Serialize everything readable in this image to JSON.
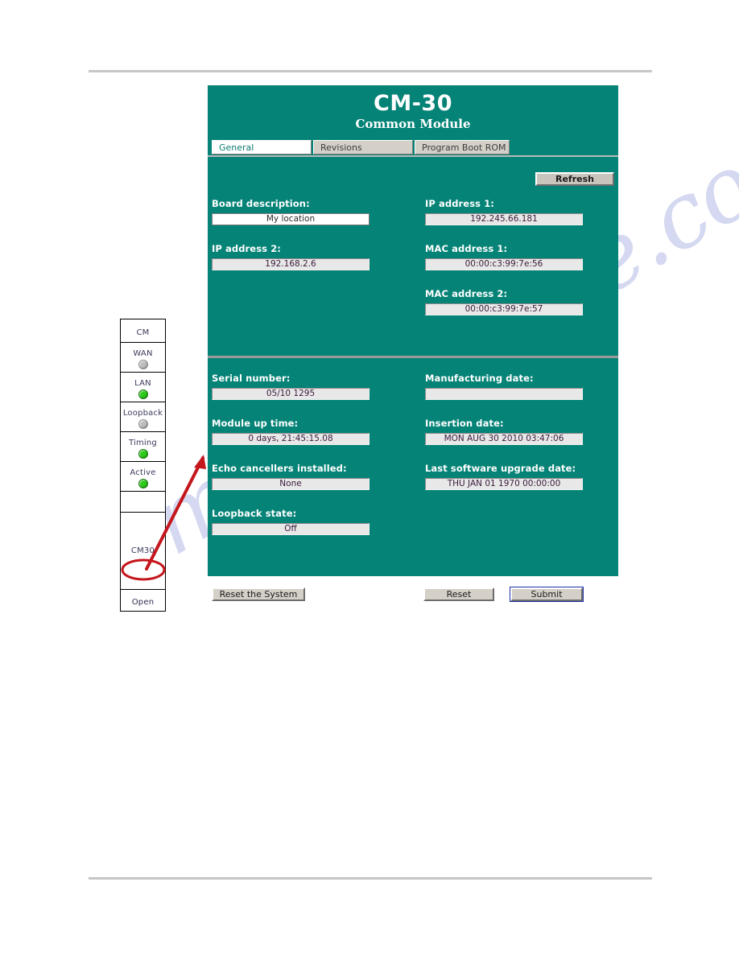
{
  "window": {
    "title": "CM-30",
    "subtitle": "Common Module"
  },
  "watermark": {
    "text": "manualshive.com"
  },
  "tabs": [
    {
      "label": "General",
      "state": "active"
    },
    {
      "label": "Revisions",
      "state": "inactive"
    },
    {
      "label": "Program Boot ROM",
      "state": "inactive"
    }
  ],
  "toolbar": {
    "refresh_label": "Refresh"
  },
  "form": {
    "board_description": {
      "label": "Board description:",
      "value": "My location",
      "editable": true
    },
    "ip_address_1": {
      "label": "IP address 1:",
      "value": "192.245.66.181",
      "editable": false
    },
    "ip_address_2": {
      "label": "IP address 2:",
      "value": "192.168.2.6",
      "editable": false
    },
    "mac_address_1": {
      "label": "MAC address 1:",
      "value": "00:00:c3:99:7e:56",
      "editable": false
    },
    "mac_address_2": {
      "label": "MAC address 2:",
      "value": "00:00:c3:99:7e:57",
      "editable": false
    },
    "serial_number": {
      "label": "Serial number:",
      "value": "05/10 1295",
      "editable": false
    },
    "manufacturing_date": {
      "label": "Manufacturing date:",
      "value": "",
      "editable": false
    },
    "module_up_time": {
      "label": "Module up time:",
      "value": "0 days, 21:45:15.08",
      "editable": false
    },
    "insertion_date": {
      "label": "Insertion date:",
      "value": "MON AUG 30 2010 03:47:06",
      "editable": false
    },
    "echo_cancellers": {
      "label": "Echo cancellers installed:",
      "value": "None",
      "editable": false
    },
    "last_software_upgrade_date": {
      "label": "Last software upgrade date:",
      "value": "THU JAN 01 1970 00:00:00",
      "editable": false
    },
    "loopback_state": {
      "label": "Loopback state:",
      "value": "Off",
      "editable": false
    }
  },
  "actions": {
    "reset_system_label": "Reset the System",
    "reset_label": "Reset",
    "submit_label": "Submit"
  },
  "module_panel": {
    "title": "CM",
    "indicators": [
      {
        "label": "WAN",
        "led": "gray"
      },
      {
        "label": "LAN",
        "led": "green"
      },
      {
        "label": "Loopback",
        "led": "gray"
      },
      {
        "label": "Timing",
        "led": "green"
      },
      {
        "label": "Active",
        "led": "green"
      }
    ],
    "slot_label": "CM30",
    "open_label": "Open"
  },
  "colors": {
    "teal_background": "#058377",
    "led_green": "#2ecc19",
    "led_gray": "#bdbdbd",
    "annotation_red": "#c4161c",
    "watermark_blue": "#8f9bd8"
  }
}
